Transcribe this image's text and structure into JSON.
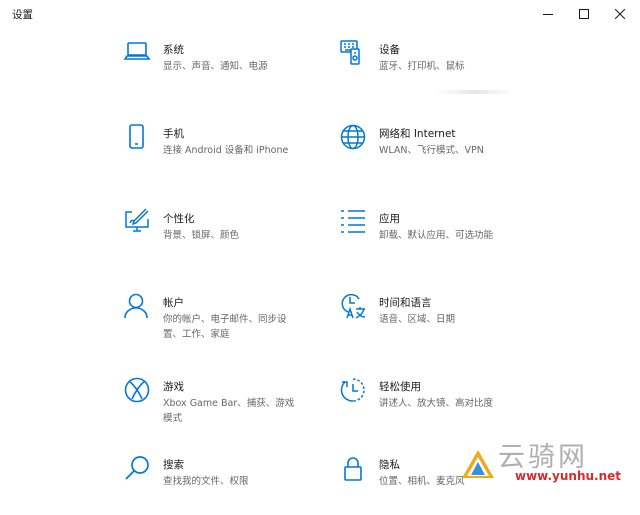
{
  "window": {
    "title": "设置",
    "controls": {
      "minimize": "minimize-icon",
      "maximize": "maximize-icon",
      "close": "close-icon"
    }
  },
  "accent_color": "#0078d7",
  "tiles": [
    {
      "name": "系统",
      "desc": "显示、声音、通知、电源",
      "icon": "laptop-icon"
    },
    {
      "name": "设备",
      "desc": "蓝牙、打印机、鼠标",
      "icon": "keyboard-device-icon"
    },
    {
      "name": "手机",
      "desc": "连接 Android 设备和 iPhone",
      "icon": "phone-icon"
    },
    {
      "name": "网络和 Internet",
      "desc": "WLAN、飞行模式、VPN",
      "icon": "globe-icon"
    },
    {
      "name": "个性化",
      "desc": "背景、锁屏、颜色",
      "icon": "paint-monitor-icon"
    },
    {
      "name": "应用",
      "desc": "卸载、默认应用、可选功能",
      "icon": "app-list-icon"
    },
    {
      "name": "帐户",
      "desc": "你的帐户、电子邮件、同步设置、工作、家庭",
      "icon": "person-icon"
    },
    {
      "name": "时间和语言",
      "desc": "语音、区域、日期",
      "icon": "clock-language-icon"
    },
    {
      "name": "游戏",
      "desc": "Xbox Game Bar、捕获、游戏模式",
      "icon": "xbox-icon"
    },
    {
      "name": "轻松使用",
      "desc": "讲述人、放大镜、高对比度",
      "icon": "ease-of-access-icon"
    },
    {
      "name": "搜索",
      "desc": "查找我的文件、权限",
      "icon": "search-icon"
    },
    {
      "name": "隐私",
      "desc": "位置、相机、麦克风",
      "icon": "lock-icon"
    }
  ],
  "watermark": {
    "text": "云骑网",
    "url": "www.yunhu.net",
    "logo": "watermark-logo-icon"
  }
}
